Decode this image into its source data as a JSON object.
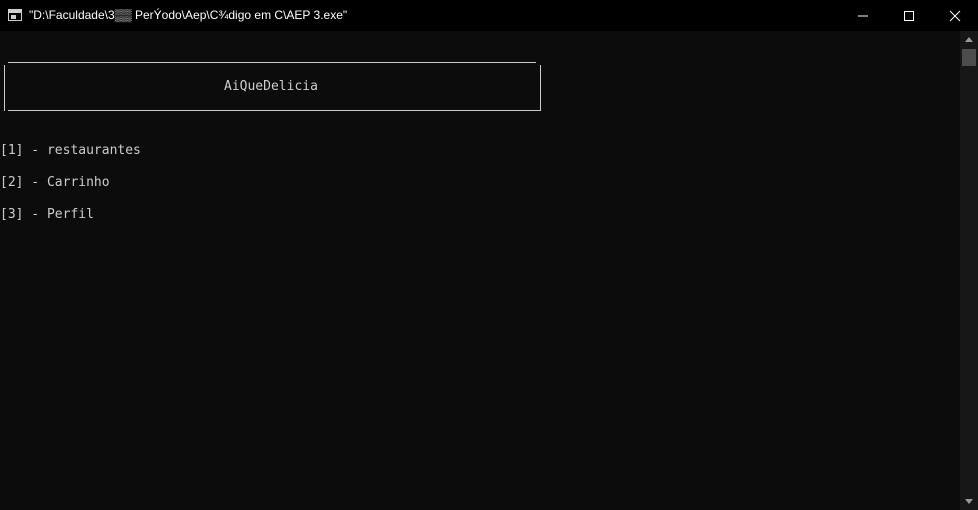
{
  "window": {
    "title": "\"D:\\Faculdade\\3▒▒ PerÝodo\\Aep\\C¾digo em C\\AEP 3.exe\""
  },
  "console": {
    "header": "AiQueDelicia",
    "menu": [
      {
        "label": "[1] - restaurantes"
      },
      {
        "label": "[2] - Carrinho"
      },
      {
        "label": "[3] - Perfil"
      }
    ]
  },
  "colors": {
    "background": "#0c0c0c",
    "text": "#cccccc",
    "titlebar": "#000000"
  },
  "icons": {
    "app": "console-app-icon",
    "minimize": "minimize-icon",
    "maximize": "maximize-icon",
    "close": "close-icon"
  }
}
